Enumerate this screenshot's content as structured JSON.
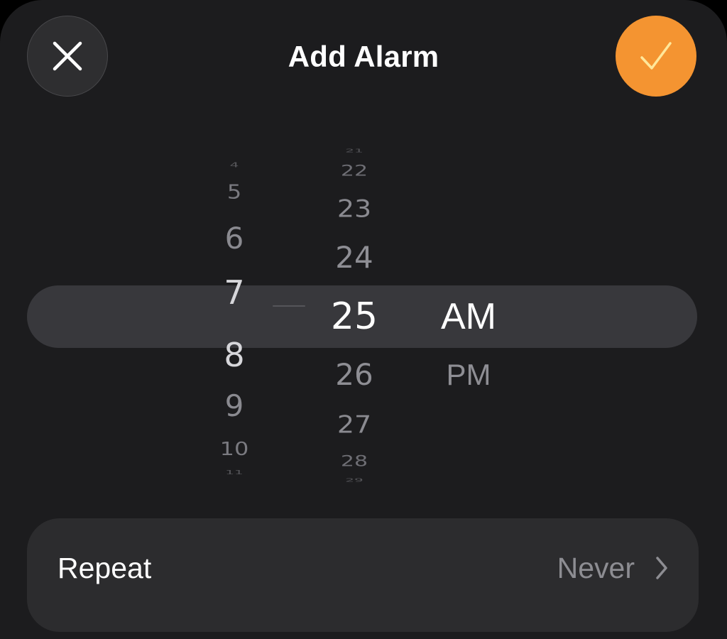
{
  "header": {
    "title": "Add Alarm",
    "cancel_icon": "close-icon",
    "confirm_icon": "checkmark-icon",
    "accent_color": "#f49431"
  },
  "picker": {
    "hours": [
      "4",
      "5",
      "6",
      "7",
      "8",
      "9",
      "10",
      "11"
    ],
    "selected_hour": "7",
    "minutes": [
      "21",
      "22",
      "23",
      "24",
      "25",
      "26",
      "27",
      "28",
      "29"
    ],
    "selected_minute": "25",
    "periods": [
      "AM",
      "PM"
    ],
    "selected_period": "AM"
  },
  "repeat": {
    "label": "Repeat",
    "value": "Never",
    "chevron_icon": "chevron-right-icon"
  }
}
